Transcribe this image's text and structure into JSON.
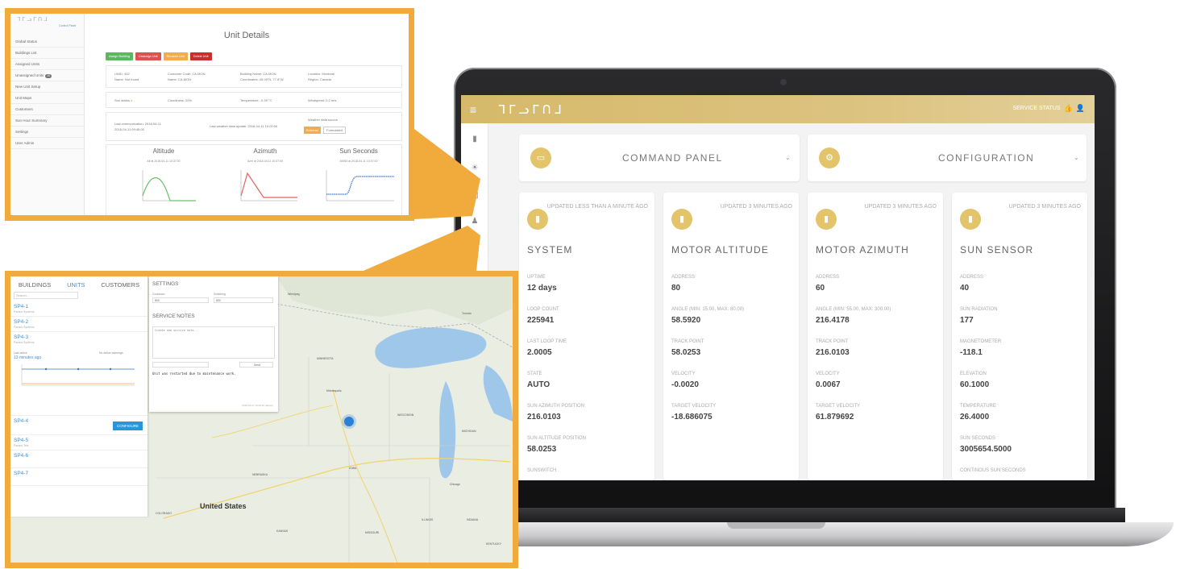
{
  "laptop": {
    "logo": "ᒣᒥᓗᒥᑎᒧ",
    "service_status": "SERVICE STATUS",
    "panels": [
      {
        "title": "COMMAND PANEL",
        "icon": "monitor-icon"
      },
      {
        "title": "CONFIGURATION",
        "icon": "gear-icon"
      }
    ],
    "cards": [
      {
        "updated": "UPDATED LESS THAN A MINUTE AGO",
        "title": "SYSTEM",
        "fields": [
          {
            "label": "UPTIME",
            "value": "12 days"
          },
          {
            "label": "LOOP COUNT",
            "value": "225941"
          },
          {
            "label": "LAST LOOP TIME",
            "value": "2.0005"
          },
          {
            "label": "STATE",
            "value": "AUTO"
          },
          {
            "label": "SUN AZIMUTH POSITION",
            "value": "216.0103"
          },
          {
            "label": "SUN ALTITUDE POSITION",
            "value": "58.0253"
          },
          {
            "label": "SUNSWITCH",
            "value": ""
          }
        ]
      },
      {
        "updated": "UPDATED 3 MINUTES AGO",
        "title": "MOTOR ALTITUDE",
        "fields": [
          {
            "label": "ADDRESS",
            "value": "80"
          },
          {
            "label": "ANGLE (MIN: 15.00, MAX: 80.00)",
            "value": "58.5920"
          },
          {
            "label": "TRACK POINT",
            "value": "58.0253"
          },
          {
            "label": "VELOCITY",
            "value": "-0.0020"
          },
          {
            "label": "TARGET VELOCITY",
            "value": "-18.686075"
          }
        ]
      },
      {
        "updated": "UPDATED 3 MINUTES AGO",
        "title": "MOTOR AZIMUTH",
        "fields": [
          {
            "label": "ADDRESS",
            "value": "60"
          },
          {
            "label": "ANGLE (MIN: 55.00, MAX: 300.00)",
            "value": "216.4178"
          },
          {
            "label": "TRACK POINT",
            "value": "216.0103"
          },
          {
            "label": "VELOCITY",
            "value": "0.0067"
          },
          {
            "label": "TARGET VELOCITY",
            "value": "61.879692"
          }
        ]
      },
      {
        "updated": "UPDATED 3 MINUTES AGO",
        "title": "SUN SENSOR",
        "fields": [
          {
            "label": "ADDRESS",
            "value": "40"
          },
          {
            "label": "SUN RADIATION",
            "value": "177"
          },
          {
            "label": "MAGNETOMETER",
            "value": "-118.1"
          },
          {
            "label": "ELEVATION",
            "value": "60.1000"
          },
          {
            "label": "TEMPERATURE",
            "value": "26.4000"
          },
          {
            "label": "SUN SECONDS",
            "value": "3005654.5000"
          },
          {
            "label": "CONTINOUS SUN SECONDS",
            "value": ""
          }
        ]
      }
    ]
  },
  "unit_details": {
    "logo": "ᒣᒥᓗᒥᑎᒧ",
    "subtitle": "Control Panel",
    "title": "Unit Details",
    "nav": [
      "Global Status",
      "Buildings List",
      "Assigned Units",
      "Unassigned Units",
      "New Unit Setup",
      "Unit Maps",
      "Customers",
      "Sun Hour Summary",
      "Settings",
      "User Admin"
    ],
    "unassigned_badge": "10",
    "buttons": [
      {
        "label": "Assign Building",
        "color": "#5cb85c"
      },
      {
        "label": "Unassign Unit",
        "color": "#d9534f"
      },
      {
        "label": "Rename Unit",
        "color": "#f0ad4e"
      },
      {
        "label": "Delete Unit",
        "color": "#c9302c"
      }
    ],
    "info": {
      "unid": "UNID: 402",
      "name": "Name: Not found",
      "customer_code": "Customer Code: CA-MON",
      "customer_name": "Name: CA-MON",
      "building_name": "Building Name: CA-MON",
      "coordinates": "Coordinates: 45.99°N, 77.8°W",
      "location": "Location: Montreal",
      "region": "Region: Canada"
    },
    "weather": {
      "sun_status": "Sun status",
      "cloudiness": "Cloudiness: 20%",
      "temperature": "Temperature: -0.39 °C",
      "windspeed": "Windspeed: 0.2 m/s"
    },
    "comm": {
      "last_comm": "Last communication: 2018-04-11",
      "last_comm_time": "2018-04-11 09:45:00",
      "last_weather": "Last weather data update: 2018-04-11 10:00:00",
      "source_label": "Weather data source",
      "source_a": "External",
      "source_b": "Forecasted"
    },
    "charts": [
      {
        "title": "Altitude",
        "sub": "Alt at 2018-04-11 10:37:00"
      },
      {
        "title": "Azimuth",
        "sub": "Azm at 2018-04-11 10:37:00"
      },
      {
        "title": "Sun Seconds",
        "sub": "44953 at 2018-04-11 10:37:00"
      }
    ]
  },
  "map_view": {
    "tabs": [
      "BUILDINGS",
      "UNITS",
      "CUSTOMERS"
    ],
    "active_tab": "UNITS",
    "search_placeholder": "Search...",
    "units": [
      {
        "name": "SP4-1",
        "sub": "Parans Systems"
      },
      {
        "name": "SP4-2",
        "sub": "Parans Systems"
      },
      {
        "name": "SP4-3",
        "sub": "Parans Systems"
      },
      {
        "name": "SP4-4",
        "sub": ""
      },
      {
        "name": "SP4-5",
        "sub": "Parans Test"
      },
      {
        "name": "SP4-6",
        "sub": ""
      },
      {
        "name": "SP4-7",
        "sub": ""
      }
    ],
    "last_active_label": "Last active",
    "last_active": "13 minutes ago",
    "no_active_warnings": "No active warnings",
    "configure": "CONFIGURE",
    "settings": {
      "title": "SETTINGS",
      "cooldown_label": "Cooldown",
      "cooldown_value": "800",
      "switching_label": "Switching",
      "switching_value": "800",
      "notes_title": "SERVICE NOTES",
      "notes_placeholder": "Create new service note...",
      "send": "Send",
      "note": "Unit was restarted due to maintenance work.",
      "note_meta": "2018-01-17 10:20:22 (admin)"
    },
    "country": "United States",
    "places": [
      "MINNESOTA",
      "WISCONSIN",
      "MICHIGAN",
      "IOWA",
      "ILLINOIS",
      "INDIANA",
      "NEBRASKA",
      "KANSAS",
      "MISSOURI",
      "COLORADO",
      "KENTUCKY",
      "Minneapolis",
      "Chicago",
      "Winnipeg",
      "Toronto"
    ]
  }
}
